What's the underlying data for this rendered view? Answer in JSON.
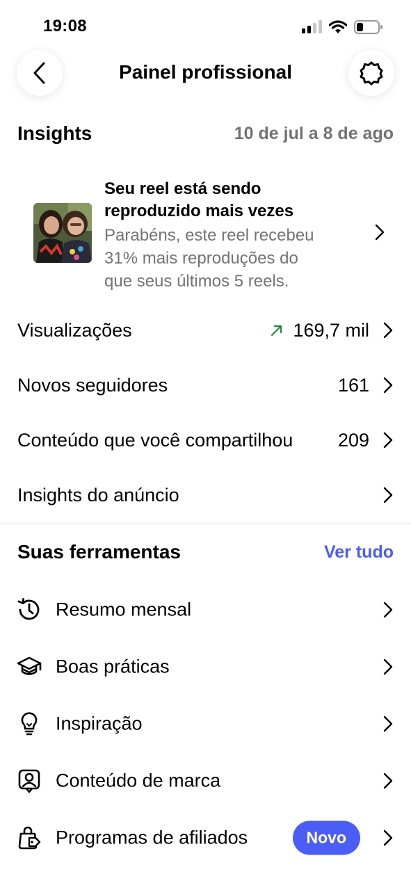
{
  "status": {
    "time": "19:08"
  },
  "header": {
    "title": "Painel profissional"
  },
  "insights": {
    "title": "Insights",
    "date_range": "10 de jul a 8 de ago",
    "reel": {
      "title_line1": "Seu reel está sendo",
      "title_line2": "reproduzido mais vezes",
      "desc_line1": "Parabéns, este reel recebeu",
      "desc_line2": "31% mais reproduções do",
      "desc_line3": "que seus últimos 5 reels."
    },
    "rows": [
      {
        "label": "Visualizações",
        "value": "169,7 mil"
      },
      {
        "label": "Novos seguidores",
        "value": "161"
      },
      {
        "label": "Conteúdo que você compartilhou",
        "value": "209"
      },
      {
        "label": "Insights do anúncio",
        "value": ""
      }
    ]
  },
  "tools": {
    "title": "Suas ferramentas",
    "see_all": "Ver tudo",
    "items": [
      {
        "label": "Resumo mensal",
        "icon": "history-clock-icon"
      },
      {
        "label": "Boas práticas",
        "icon": "graduation-cap-icon"
      },
      {
        "label": "Inspiração",
        "icon": "lightbulb-icon"
      },
      {
        "label": "Conteúdo de marca",
        "icon": "branded-content-icon"
      },
      {
        "label": "Programas de afiliados",
        "icon": "shopping-bag-tag-icon",
        "badge": "Novo"
      }
    ]
  },
  "colors": {
    "accent": "#4a5df5",
    "trend_up": "#1d8a3a",
    "muted": "#737373"
  }
}
